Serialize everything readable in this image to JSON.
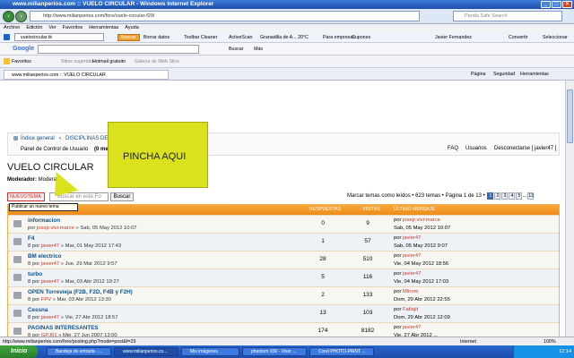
{
  "window": {
    "title": "www.milianperios.com :: VUELO CIRCULAR - Windows Internet Explorer"
  },
  "address": {
    "url": "http://www.milianperios.com/foro/vuelo-circular-f29/",
    "search_placeholder": "Panda Safe Search"
  },
  "menu": [
    "Archivo",
    "Edición",
    "Ver",
    "Favoritos",
    "Herramientas",
    "Ayuda"
  ],
  "toolbar1": {
    "search_field": "vuelocircular.tk",
    "buscar": "Buscar",
    "borrar": "Borrar datos",
    "cleaner": "Toolbar Cleaner",
    "activescan": "ActiveScan",
    "weather": "Granadilla de A... 20°C",
    "empresas": "Para empresas",
    "cupones": "Cupones",
    "user": "Javier Fernandez",
    "convertir": "Convertir",
    "seleccionar": "Seleccionar"
  },
  "toolbar2": {
    "google": "Google",
    "buscar": "Buscar",
    "mas": "Más"
  },
  "favbar": {
    "favoritos": "Favoritos",
    "sitios": "Sitios sugeridos",
    "hotmail": "Hotmail gratuito",
    "galeria": "Galería de Web Slice"
  },
  "tab": {
    "label": "www.milianperios.com :: VUELO CIRCULAR",
    "pagina": "Página",
    "seguridad": "Seguridad",
    "herramientas": "Herramientas"
  },
  "breadcrumb": {
    "index": "Índice general",
    "sep": "‹",
    "cat": "DISCIPLINAS DE VUE",
    "panel": "Panel de Control de Usuario",
    "mensajes": "(0 mensaje",
    "faq": "FAQ",
    "usuarios": "Usuarios",
    "logout": "Desconectarse [ javier47 ]"
  },
  "callout": {
    "text": "PINCHA AQUI"
  },
  "forum": {
    "title": "VUELO CIRCULAR",
    "moderator_label": "Moderador:",
    "moderator_name": "Moderad"
  },
  "actions": {
    "newtopic": "NUEVOTEMA",
    "tooltip": "Publicar un nuevo tema",
    "search_placeholder": "Buscar en este Fo",
    "search_btn": "Buscar"
  },
  "pagination": {
    "text": "Marcar temas como leídos • 623 temas • Página 1 de 13 •",
    "pages": [
      "1",
      "2",
      "3",
      "4",
      "5",
      "...",
      "13"
    ]
  },
  "table": {
    "headers": [
      "TEMAS",
      "RESPUESTAS",
      "VISITAS",
      "ÚLTIMO MENSAJE"
    ],
    "rows": [
      {
        "title": "informacion",
        "by": "por",
        "author": "josep vivi-marce",
        "date": "» Sab, 05 May 2012 10:07",
        "replies": "0",
        "views": "9",
        "last_by": "por",
        "last_author": "josep vivi-marce",
        "last_date": "Sab, 05 May 2012 10:07"
      },
      {
        "title": "F4",
        "by": "8 por",
        "author": "javier47",
        "date": "» Mar, 01 May 2012 17:43",
        "replies": "1",
        "views": "57",
        "last_by": "por",
        "last_author": "javier47",
        "last_date": "Sab, 05 May 2012 9:07"
      },
      {
        "title": "BM electrico",
        "by": "8 por",
        "author": "javier47",
        "date": "» Jue, 29 Mar 2012 9:57",
        "replies": "28",
        "views": "510",
        "last_by": "por",
        "last_author": "javier47",
        "last_date": "Vie, 04 May 2012 18:56"
      },
      {
        "title": "turbo",
        "by": "8 por",
        "author": "javier47",
        "date": "» Mar, 03 Abr 2012 19:27",
        "replies": "5",
        "views": "116",
        "last_by": "por",
        "last_author": "javier47",
        "last_date": "Vie, 04 May 2012 17:03"
      },
      {
        "title": "OPEN Torrevieja (F2B, F2D, F4B y F2H)",
        "by": "8 por",
        "author": "FPV",
        "date": "» Mar, 03 Abr 2012 13:30",
        "replies": "2",
        "views": "133",
        "last_by": "por",
        "last_author": "Milrom",
        "last_date": "Dom, 29 Abr 2012 22:55"
      },
      {
        "title": "Cessna",
        "by": "8 por",
        "author": "javier47",
        "date": "» Vie, 27 Abr 2012 18:57",
        "replies": "13",
        "views": "103",
        "last_by": "por",
        "last_author": "Fatlajit",
        "last_date": "Dom, 29 Abr 2012 12:09"
      },
      {
        "title": "PAGINAS INTERESANTES",
        "by": "8 por",
        "author": "GPJ01",
        "date": "» Mié, 27 Jun 2007 13:00",
        "replies": "174",
        "views": "8182",
        "last_by": "por",
        "last_author": "javier47",
        "last_date": "Vie, 27 Abr 2012 ..."
      }
    ]
  },
  "status": {
    "text": "http://www.milianperios.com/foro/posting.php?mode=post&f=29",
    "zone": "Internet",
    "zoom": "100%"
  },
  "taskbar": {
    "start": "Inicio",
    "items": [
      "Bandeja de entrada - ...",
      "www.milianperios.co...",
      "Mis imágenes",
      "phantom 036 - Visor ...",
      "Corel PHOTO-PAINT ..."
    ],
    "clock": "12:14"
  }
}
